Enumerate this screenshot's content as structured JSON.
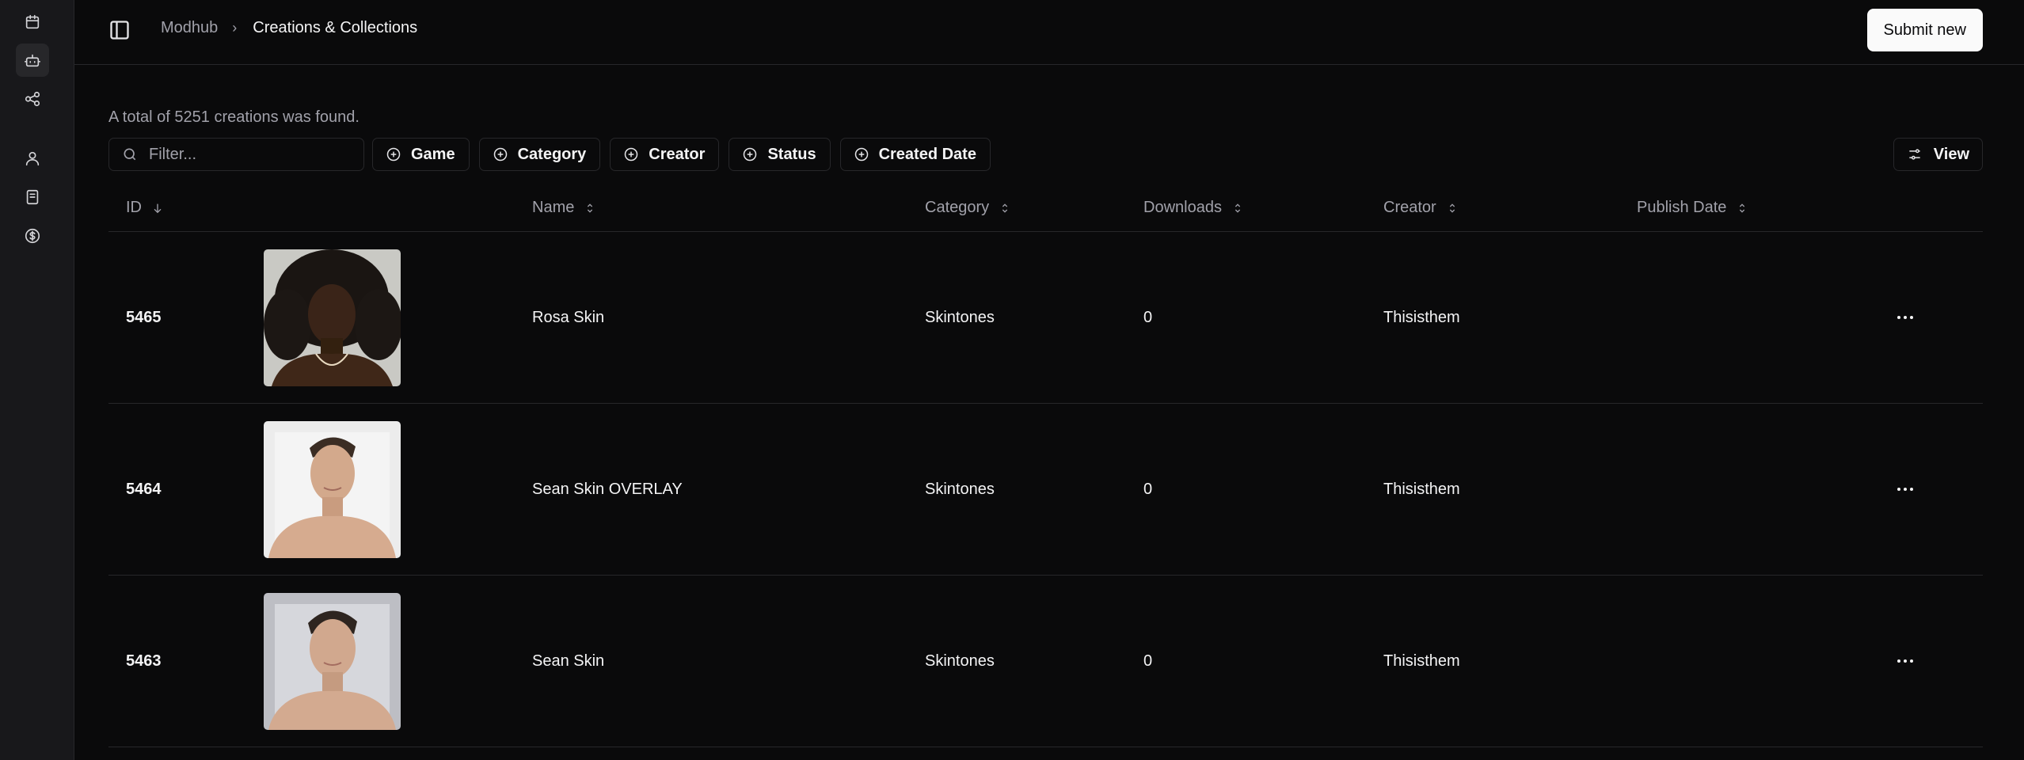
{
  "breadcrumb": {
    "root": "Modhub",
    "current": "Creations & Collections"
  },
  "header": {
    "submit_label": "Submit new"
  },
  "summary": "A total of 5251 creations was found.",
  "filter": {
    "placeholder": "Filter..."
  },
  "chips": [
    "Game",
    "Category",
    "Creator",
    "Status",
    "Created Date"
  ],
  "view_label": "View",
  "rail_icons": [
    "calendar-icon",
    "bot-icon",
    "share-icon",
    "user-icon",
    "notebook-icon",
    "dollar-icon"
  ],
  "columns": {
    "id": "ID",
    "name": "Name",
    "category": "Category",
    "downloads": "Downloads",
    "creator": "Creator",
    "publish_date": "Publish Date"
  },
  "rows": [
    {
      "id": "5465",
      "name": "Rosa Skin",
      "category": "Skintones",
      "downloads": "0",
      "creator": "Thisisthem",
      "publish_date": ""
    },
    {
      "id": "5464",
      "name": "Sean Skin OVERLAY",
      "category": "Skintones",
      "downloads": "0",
      "creator": "Thisisthem",
      "publish_date": ""
    },
    {
      "id": "5463",
      "name": "Sean Skin",
      "category": "Skintones",
      "downloads": "0",
      "creator": "Thisisthem",
      "publish_date": ""
    }
  ],
  "colors": {
    "background": "#0a0a0b",
    "rail": "#18181b",
    "border": "#27272a",
    "muted": "#a1a1aa",
    "accent_button": "#fafafa"
  }
}
